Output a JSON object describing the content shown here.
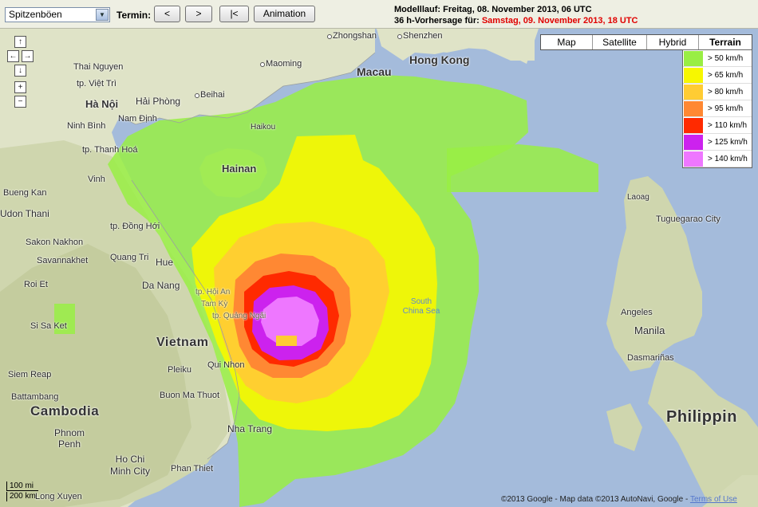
{
  "toolbar": {
    "product": "Spitzenböen",
    "termin_label": "Termin:",
    "prev": "<",
    "next": ">",
    "first": "|<",
    "animation": "Animation",
    "run_line": "Modelllauf: Freitag, 08. November 2013, 06 UTC",
    "forecast_prefix": "36 h-Vorhersage für: ",
    "forecast_time": "Samstag, 09. November 2013, 18 UTC"
  },
  "map_types": {
    "items": [
      "Map",
      "Satellite",
      "Hybrid",
      "Terrain"
    ],
    "active": "Terrain"
  },
  "legend": {
    "items": [
      {
        "label": "> 50 km/h",
        "color": "#99ee44"
      },
      {
        "label": "> 65 km/h",
        "color": "#f7f700"
      },
      {
        "label": "> 80 km/h",
        "color": "#ffcc33"
      },
      {
        "label": "> 95 km/h",
        "color": "#ff8833"
      },
      {
        "label": "> 110 km/h",
        "color": "#ff2a00"
      },
      {
        "label": "> 125 km/h",
        "color": "#cc22ee"
      },
      {
        "label": "> 140 km/h",
        "color": "#ee77ff"
      }
    ]
  },
  "nav_controls": {
    "up": "↑",
    "left": "←",
    "right": "→",
    "down": "↓",
    "zoom_in": "+",
    "zoom_out": "−"
  },
  "labels": {
    "hong_kong": "Hong Kong",
    "macau": "Macau",
    "shenzhen": "Shenzhen",
    "zhongshan": "Zhongshan",
    "maoming": "Maoming",
    "beihai": "Beihai",
    "haikou": "Haikou",
    "hainan": "Hainan",
    "thai_nguyen": "Thai Nguyen",
    "viet_tri": "tp. Việt Trì",
    "ha_noi": "Hà Nội",
    "hai_phong": "Hải Phòng",
    "ninh_binh": "Ninh Bình",
    "nam_dinh": "Nam Định",
    "thanh_hoa": "tp. Thanh Hoá",
    "vinh": "Vinh",
    "bueng_kan": "Bueng Kan",
    "udon_thani": "Udon Thani",
    "dong_hoi": "tp. Đồng Hới",
    "sakon_nakhon": "Sakon Nakhon",
    "savannakhet": "Savannakhet",
    "quang_tri": "Quang Tri",
    "hue": "Hue",
    "da_nang": "Da Nang",
    "roi_et": "Roi Et",
    "hoi_an": "tp. Hội An",
    "tam_ky": "Tam Kỳ",
    "quang_ngai": "tp. Quảng Ngãi",
    "si_sa_ket": "Si Sa Ket",
    "vietnam": "Vietnam",
    "south_china_sea": "South China Sea",
    "pleiku": "Pleiku",
    "qui_nhon": "Qui Nhon",
    "siem_reap": "Siem Reap",
    "battambang": "Battambang",
    "cambodia": "Cambodia",
    "buon_ma_thuot": "Buon Ma Thuot",
    "nha_trang": "Nha Trang",
    "phnom_penh": "Phnom Penh",
    "ho_chi_minh": "Ho Chi Minh City",
    "phan_thiet": "Phan Thiet",
    "long_xuyen": "Long Xuyen",
    "laoag": "Laoag",
    "tuguegarao": "Tuguegarao City",
    "angeles": "Angeles",
    "manila": "Manila",
    "dasmarinas": "Dasmariñas",
    "philippines": "Philippin"
  },
  "scale": {
    "miles": "100 mi",
    "km": "200 km"
  },
  "copyright": {
    "text": "©2013 Google - Map data ©2013 AutoNavi, Google - ",
    "terms": "Terms of Use"
  }
}
